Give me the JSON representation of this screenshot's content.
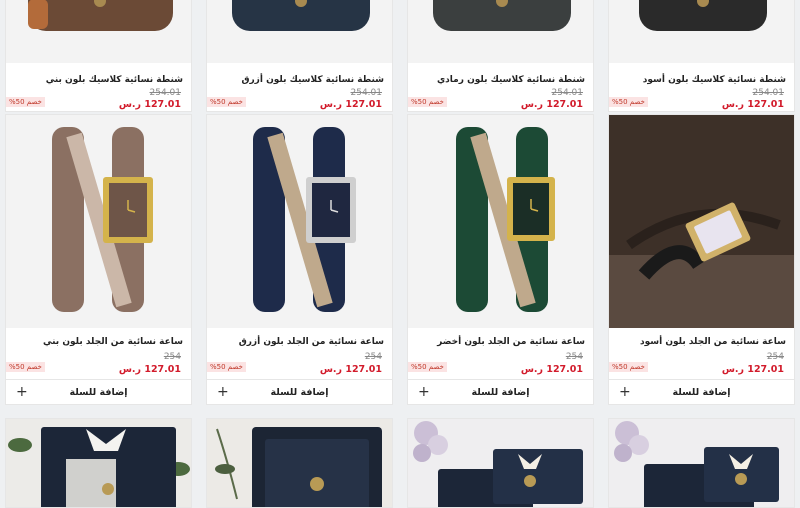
{
  "currency": "ر.س",
  "row1": [
    {
      "title": "شنطة نسائية كلاسيك بلون بني",
      "old_price": "254.01",
      "new_price": "127.01 ر.س",
      "badge": "خصم 50%",
      "color": "#6b4a36"
    },
    {
      "title": "شنطة نسائية كلاسيك بلون أزرق",
      "old_price": "254.01",
      "new_price": "127.01 ر.س",
      "badge": "خصم 50%",
      "color": "#263445"
    },
    {
      "title": "شنطة نسائية كلاسيك بلون رمادي",
      "old_price": "254.01",
      "new_price": "127.01 ر.س",
      "badge": "خصم 50%",
      "color": "#3b3f3f"
    },
    {
      "title": "شنطة نسائية كلاسيك بلون أسود",
      "old_price": "254.01",
      "new_price": "127.01 ر.س",
      "badge": "خصم 50%",
      "color": "#2a2a2a"
    }
  ],
  "row2": [
    {
      "title": "ساعة نسائية من الجلد بلون بني",
      "old_price": "254",
      "new_price": "127.01 ر.س",
      "badge": "خصم 50%",
      "strap": "#8b7062",
      "face": "#6e5548",
      "case": "#d4b34b"
    },
    {
      "title": "ساعة نسائية من الجلد بلون أزرق",
      "old_price": "254",
      "new_price": "127.01 ر.س",
      "badge": "خصم 50%",
      "strap": "#1e2b4a",
      "face": "#1f2740",
      "case": "#c8c8c8"
    },
    {
      "title": "ساعة نسائية من الجلد بلون أخضر",
      "old_price": "254",
      "new_price": "127.01 ر.س",
      "badge": "خصم 50%",
      "strap": "#1c4a35",
      "face": "#1b2e26",
      "case": "#d4b34b"
    },
    {
      "title": "ساعة نسائية من الجلد بلون أسود",
      "old_price": "254",
      "new_price": "127.01 ر.س",
      "badge": "خصم 50%",
      "strap": "#1e1e1e",
      "face": "#e8e4ef",
      "case": "#d1b26a"
    }
  ],
  "cart_label": "إضافة للسلة",
  "plus_icon": "+"
}
